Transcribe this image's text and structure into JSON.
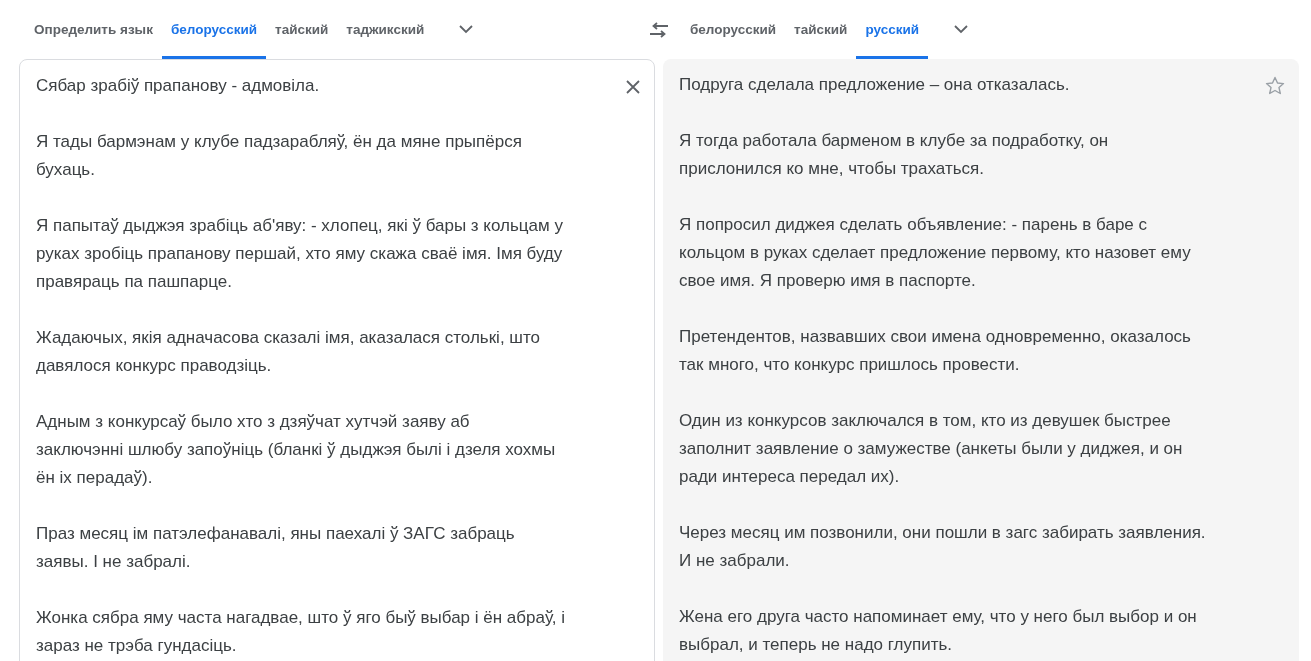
{
  "source_tabs": [
    {
      "label": "Определить язык",
      "selected": false
    },
    {
      "label": "белорусский",
      "selected": true
    },
    {
      "label": "тайский",
      "selected": false
    },
    {
      "label": "таджикский",
      "selected": false
    }
  ],
  "target_tabs": [
    {
      "label": "белорусский",
      "selected": false
    },
    {
      "label": "тайский",
      "selected": false
    },
    {
      "label": "русский",
      "selected": true
    }
  ],
  "source_text": [
    [
      "Сябар зрабіў прапанову - адмовіла."
    ],
    [
      "Я тады бармэнам у клубе падзарабляў, ён да мяне прыпёрся",
      "бухаць."
    ],
    [
      "Я папытаў дыджэя зрабіць аб'яву: - хлопец, які ў бары з кольцам у",
      "руках зробіць прапанову першай, хто яму скажа сваё імя. Імя буду",
      "правяраць па пашпарце."
    ],
    [
      "Жадаючых, якія адначасова сказалі імя, аказалася столькі, што",
      "давялося конкурс праводзіць."
    ],
    [
      "Адным з конкурсаў было хто з дзяўчат хутчэй заяву аб",
      "заключэнні шлюбу запоўніць (бланкі ў дыджэя былі і дзеля хохмы",
      "ён іх перадаў)."
    ],
    [
      "Праз месяц ім патэлефанавалі, яны паехалі ў ЗАГС забраць",
      "заявы. І не забралі."
    ],
    [
      "Жонка сябра яму часта нагадвае, што ў яго быў выбар і ён абраў, і",
      "зараз не трэба гундасіць."
    ]
  ],
  "translation": [
    [
      "Подруга сделала предложение – она отказалась."
    ],
    [
      "Я тогда работала барменом в клубе за подработку, он",
      "прислонился ко мне, чтобы трахаться."
    ],
    [
      "Я попросил диджея сделать объявление: - парень в баре с",
      "кольцом в руках сделает предложение первому, кто назовет ему",
      "свое имя. Я проверю имя в паспорте."
    ],
    [
      "Претендентов, назвавших свои имена одновременно, оказалось",
      "так много, что конкурс пришлось провести."
    ],
    [
      "Один из конкурсов заключался в том, кто из девушек быстрее",
      "заполнит заявление о замужестве (анкеты были у диджея, и он",
      "ради интереса передал их)."
    ],
    [
      "Через месяц им позвонили, они пошли в загс забирать заявления.",
      "И не забрали."
    ],
    [
      "Жена его друга часто напоминает ему, что у него был выбор и он",
      "выбрал, и теперь не надо глупить."
    ]
  ]
}
